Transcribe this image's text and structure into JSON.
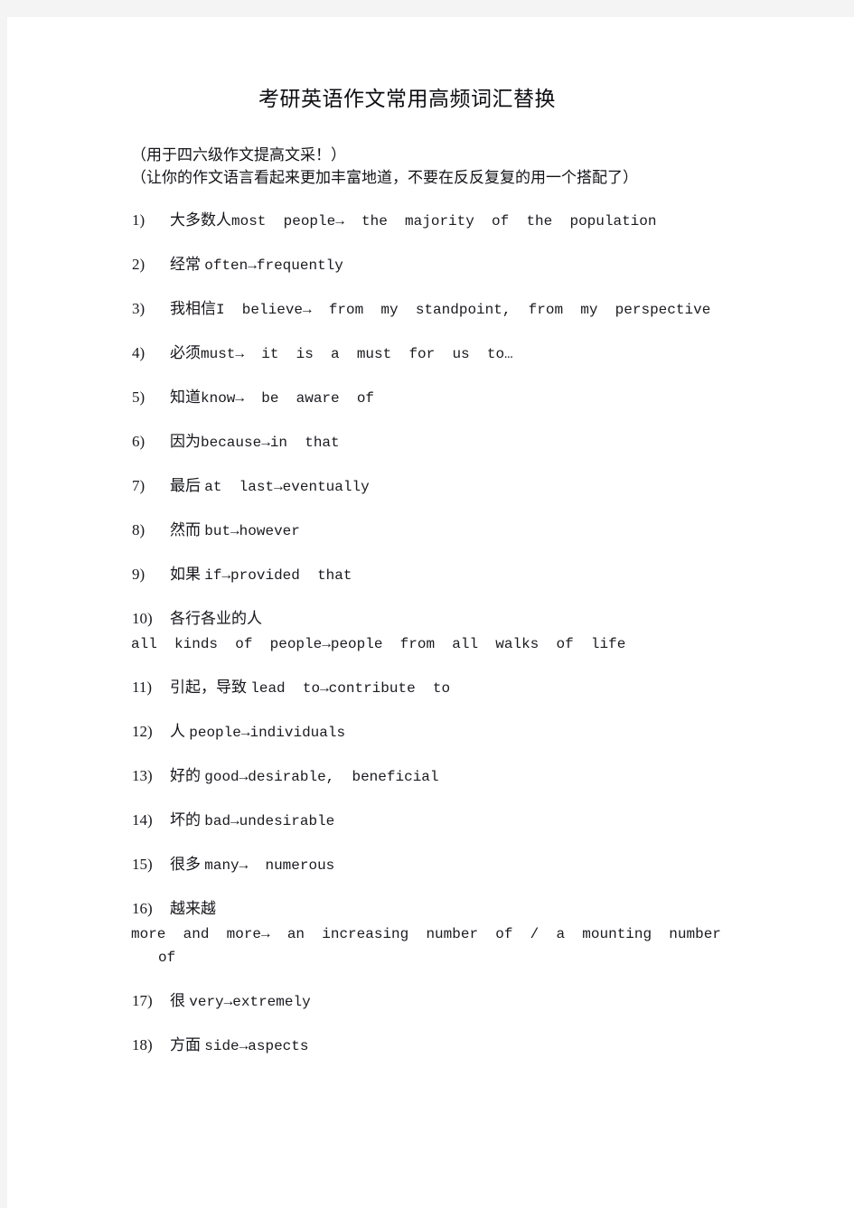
{
  "document": {
    "title": "考研英语作文常用高频词汇替换",
    "intro_lines": [
      "（用于四六级作文提高文采！）",
      "（让你的作文语言看起来更加丰富地道，不要在反反复复的用一个搭配了）"
    ]
  },
  "entries": [
    {
      "number": "1)",
      "chinese": "大多数人",
      "english": "most  people→  the  majority  of  the  population",
      "layout": "inline"
    },
    {
      "number": "2)",
      "chinese": "经常 ",
      "english": "often→frequently",
      "layout": "inline"
    },
    {
      "number": "3)",
      "chinese": "我相信",
      "english": "I  believe→  from  my  standpoint,  from  my  perspective",
      "layout": "inline"
    },
    {
      "number": "4)",
      "chinese": "必须",
      "english": "must→  it  is  a  must  for  us  to…",
      "layout": "inline"
    },
    {
      "number": "5)",
      "chinese": "知道",
      "english": "know→  be  aware  of",
      "layout": "inline"
    },
    {
      "number": "6)",
      "chinese": "因为",
      "english": "because→in  that",
      "layout": "inline"
    },
    {
      "number": "7)",
      "chinese": "最后 ",
      "english": "at  last→eventually",
      "layout": "inline"
    },
    {
      "number": "8)",
      "chinese": "然而 ",
      "english": "but→however",
      "layout": "inline"
    },
    {
      "number": "9)",
      "chinese": "如果 ",
      "english": "if→provided  that",
      "layout": "inline"
    },
    {
      "number": "10)",
      "chinese": "各行各业的人",
      "english": "all  kinds  of  people→people  from  all  walks  of  life",
      "english_cont": "",
      "layout": "wrapped"
    },
    {
      "number": "11)",
      "chinese": "引起，导致 ",
      "english": "lead  to→contribute  to",
      "layout": "inline"
    },
    {
      "number": "12)",
      "chinese": "人 ",
      "english": "people→individuals",
      "layout": "inline"
    },
    {
      "number": "13)",
      "chinese": "好的 ",
      "english": "good→desirable,  beneficial",
      "layout": "inline"
    },
    {
      "number": "14)",
      "chinese": "坏的 ",
      "english": "bad→undesirable",
      "layout": "inline"
    },
    {
      "number": "15)",
      "chinese": "很多 ",
      "english": "many→  numerous",
      "layout": "inline"
    },
    {
      "number": "16)",
      "chinese": "越来越",
      "english": "more  and  more→  an  increasing  number  of  /  a  mounting  number",
      "english_cont": "of",
      "layout": "wrapped"
    },
    {
      "number": "17)",
      "chinese": "很 ",
      "english": "very→extremely",
      "layout": "inline"
    },
    {
      "number": "18)",
      "chinese": "方面 ",
      "english": "side→aspects",
      "layout": "inline"
    }
  ],
  "colors": {
    "page_background": "#ffffff",
    "canvas_background": "#f4f4f4",
    "text": "#16161c"
  }
}
